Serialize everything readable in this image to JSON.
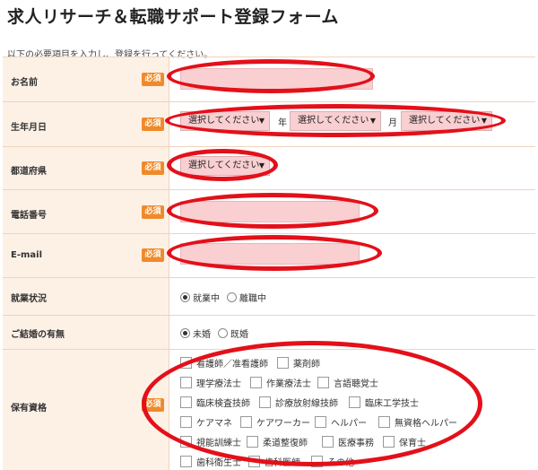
{
  "page": {
    "title": "求人リサーチ＆転職サポート登録フォーム",
    "intro": "以下の必要項目を入力し、登録を行ってください。"
  },
  "required_badge": "必須",
  "fields": {
    "name": {
      "label": "お名前"
    },
    "birthdate": {
      "label": "生年月日",
      "year_value": "選択してください",
      "year_unit": "年",
      "month_value": "選択してください",
      "month_unit": "月",
      "day_value": "選択してください"
    },
    "prefecture": {
      "label": "都道府県",
      "value": "選択してください"
    },
    "phone": {
      "label": "電話番号"
    },
    "email": {
      "label": "E-mail"
    },
    "employment": {
      "label": "就業状況",
      "options": [
        "就業中",
        "離職中"
      ],
      "selected": "就業中"
    },
    "marital": {
      "label": "ご結婚の有無",
      "options": [
        "未婚",
        "既婚"
      ],
      "selected": "未婚"
    },
    "qualifications": {
      "label": "保有資格",
      "options": [
        "看護師／准看護師",
        "薬剤師",
        "理学療法士",
        "作業療法士",
        "言語聴覚士",
        "臨床検査技師",
        "診療放射線技師",
        "臨床工学技士",
        "ケアマネ",
        "ケアワーカー",
        "ヘルパー",
        "無資格ヘルパー",
        "視能訓練士",
        "柔道整復師",
        "医療事務",
        "保育士",
        "歯科衛生士",
        "歯科医師",
        "その他"
      ]
    }
  },
  "colors": {
    "header_bg": "#fdf1e6",
    "required_badge": "#ef8a2b",
    "input_bg": "#f9cfd1",
    "annotation_red": "#e3101a"
  }
}
